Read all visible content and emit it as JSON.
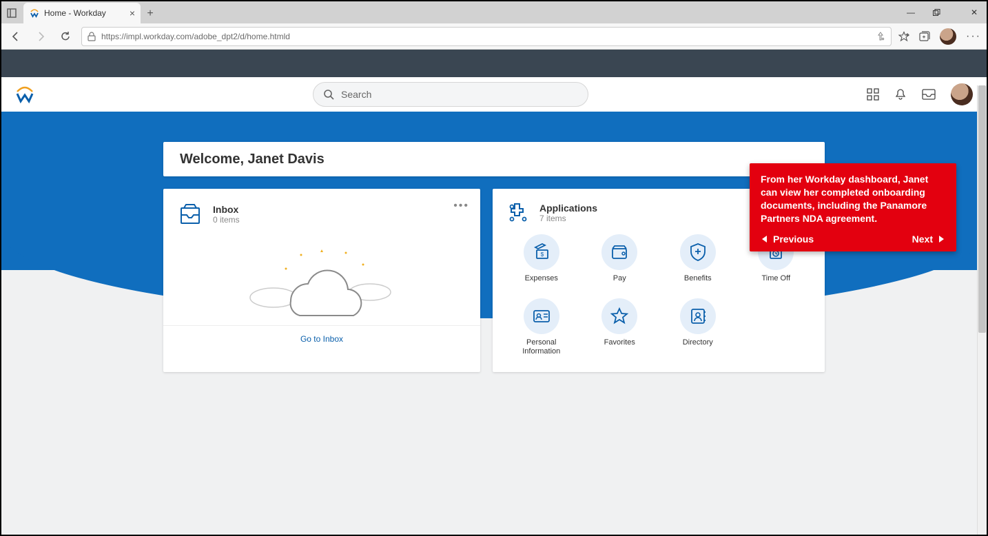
{
  "browser": {
    "tab_title": "Home - Workday",
    "url": "https://impl.workday.com/adobe_dpt2/d/home.htmld"
  },
  "appbar": {
    "search_placeholder": "Search"
  },
  "welcome": "Welcome, Janet Davis",
  "inbox": {
    "title": "Inbox",
    "count_text": "0 items",
    "link": "Go to Inbox"
  },
  "applications": {
    "title": "Applications",
    "count_text": "7 items",
    "items": [
      {
        "label": "Expenses",
        "icon": "expenses"
      },
      {
        "label": "Pay",
        "icon": "pay"
      },
      {
        "label": "Benefits",
        "icon": "benefits"
      },
      {
        "label": "Time Off",
        "icon": "timeoff"
      },
      {
        "label": "Personal Information",
        "icon": "personal"
      },
      {
        "label": "Favorites",
        "icon": "favorites"
      },
      {
        "label": "Directory",
        "icon": "directory"
      }
    ]
  },
  "callout": {
    "text": "From her Workday dashboard, Janet can view her completed onboarding documents, including the Panamore Partners NDA agreement.",
    "prev": "Previous",
    "next": "Next"
  }
}
